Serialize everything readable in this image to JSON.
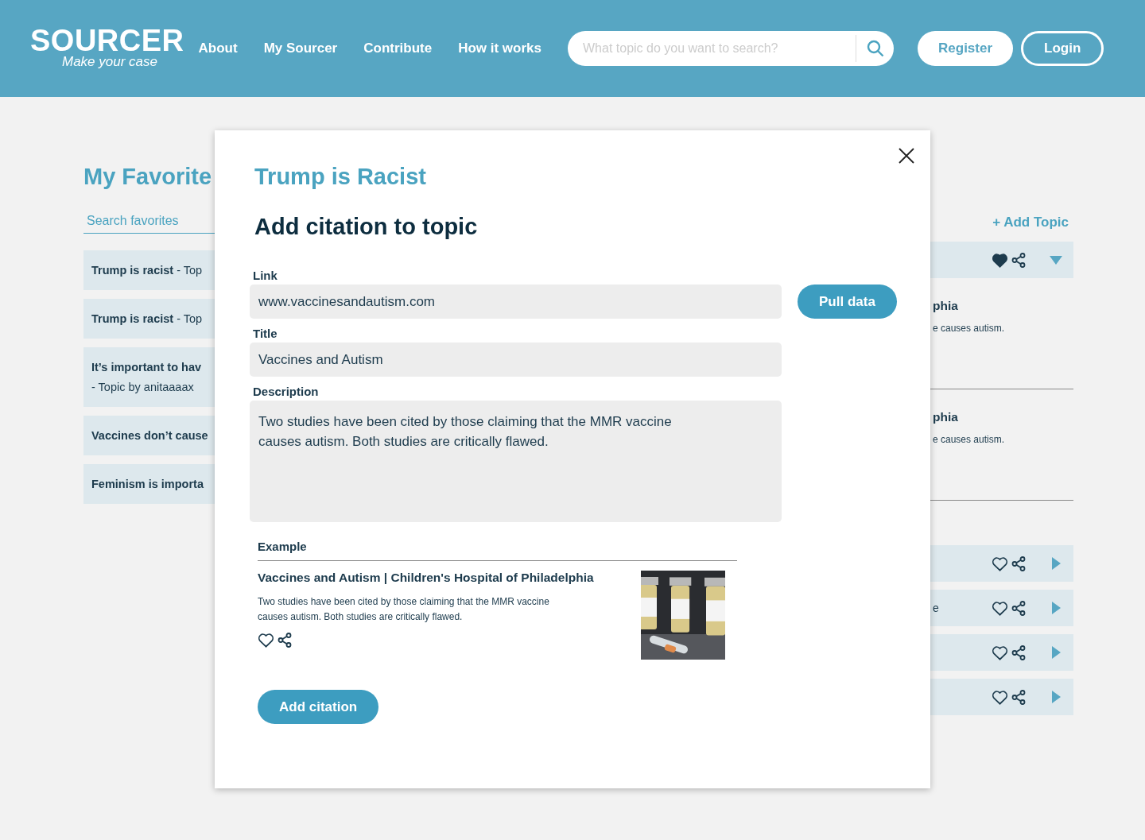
{
  "header": {
    "logo": {
      "name": "SOURCER",
      "tagline": "Make your case"
    },
    "nav": [
      "About",
      "My Sourcer",
      "Contribute",
      "How it works"
    ],
    "search": {
      "placeholder": "What topic do you want to search?"
    },
    "buttons": [
      {
        "label": "Register",
        "kind": "filled"
      },
      {
        "label": "Login",
        "kind": "outline"
      }
    ]
  },
  "favorites": {
    "title": "My Favorite",
    "search": {
      "placeholder": "Search favorites"
    },
    "items": [
      {
        "title": "Trump is racist",
        "byline": " - Top"
      },
      {
        "title": "Trump is racist",
        "byline": " - Top"
      },
      {
        "title": "It’s important to hav",
        "byline": "- Topic by anitaaaax"
      },
      {
        "title": "Vaccines don’t cause"
      },
      {
        "title": "Feminism is importa"
      }
    ]
  },
  "topics_panel": {
    "add_topic": "+ Add Topic",
    "topics": [
      {
        "favorited": true,
        "expanded": true,
        "citations": [
          {
            "title": "phia",
            "description": "e causes autism."
          },
          {
            "title": "phia",
            "description": "e causes autism."
          }
        ]
      },
      {
        "favorited": false,
        "expanded": false
      },
      {
        "text": "e",
        "favorited": false,
        "expanded": false
      },
      {
        "favorited": false,
        "expanded": false
      },
      {
        "favorited": false,
        "expanded": false
      }
    ]
  },
  "modal": {
    "topic": "Trump is Racist",
    "heading": "Add citation to topic",
    "fields": [
      {
        "kind": "input",
        "label": "Link",
        "value": "www.vaccinesandautism.com"
      },
      {
        "kind": "input",
        "label": "Title",
        "value": "Vaccines and Autism"
      },
      {
        "kind": "textarea",
        "label": "Description",
        "value": "Two studies have been cited by those claiming that the MMR vaccine causes autism. Both studies are critically flawed."
      }
    ],
    "pull_button": "Pull data",
    "example": {
      "label": "Example",
      "title": "Vaccines and Autism | Children's Hospital of Philadelphia",
      "description": "Two studies have been cited by those claiming that the MMR vaccine causes autism. Both studies are critically flawed.",
      "favorited": false
    },
    "submit": "Add citation"
  }
}
